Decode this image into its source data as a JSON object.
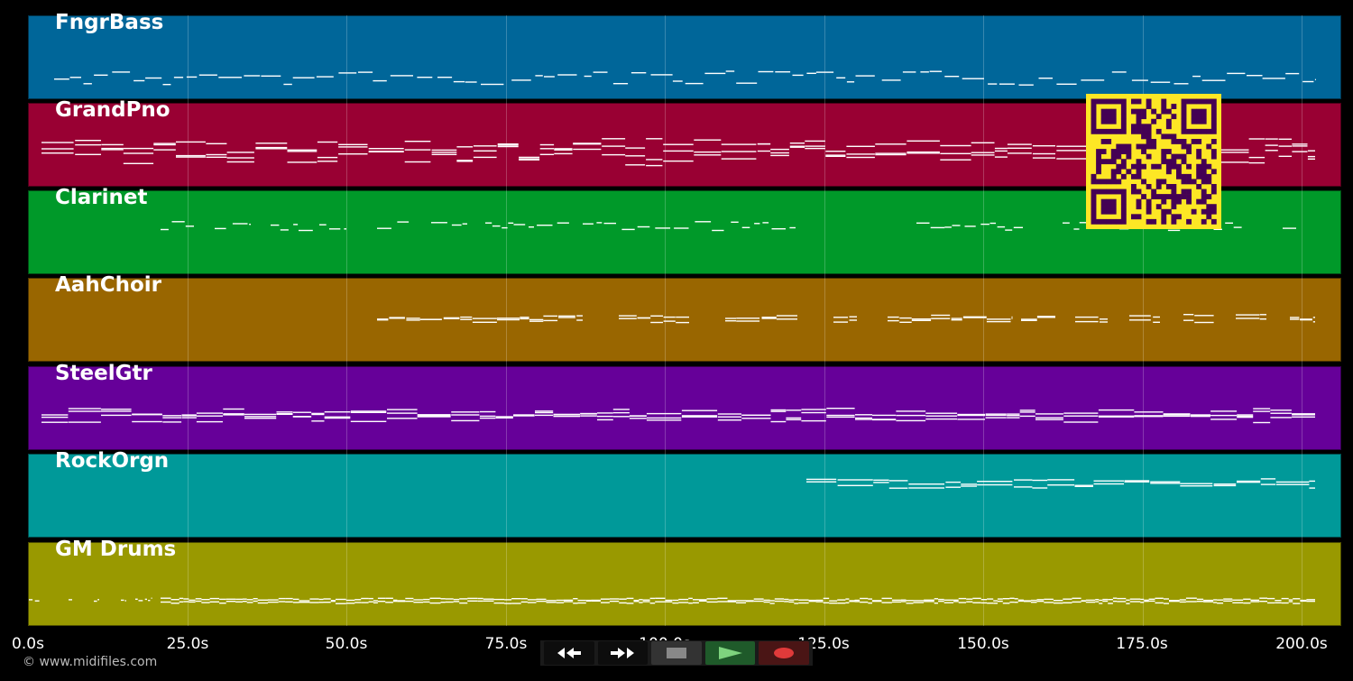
{
  "tracks": [
    {
      "name": "FngrBass",
      "color": "#006699",
      "note_pattern": "bass"
    },
    {
      "name": "GrandPno",
      "color": "#990033",
      "note_pattern": "piano"
    },
    {
      "name": "Clarinet",
      "color": "#009929",
      "note_pattern": "clarinet"
    },
    {
      "name": "AahChoir",
      "color": "#996600",
      "note_pattern": "choir"
    },
    {
      "name": "SteelGtr",
      "color": "#660099",
      "note_pattern": "guitar"
    },
    {
      "name": "RockOrgn",
      "color": "#009999",
      "note_pattern": "organ"
    },
    {
      "name": "GM Drums",
      "color": "#999900",
      "note_pattern": "drums"
    }
  ],
  "time_axis": {
    "unit": "s",
    "ticks": [
      "0.0s",
      "25.0s",
      "50.0s",
      "75.0s",
      "100.0s",
      "125.0s",
      "150.0s",
      "175.0s",
      "200.0s"
    ],
    "max_seconds": 206
  },
  "copyright": "© www.midifiles.com",
  "transport": {
    "rewind": "rewind-icon",
    "fast_forward": "fast-forward-icon",
    "stop": "stop-icon",
    "play": "play-icon",
    "record": "record-icon"
  },
  "qr_code": {
    "colors": {
      "fg": "#440154",
      "bg": "#fde725"
    }
  }
}
